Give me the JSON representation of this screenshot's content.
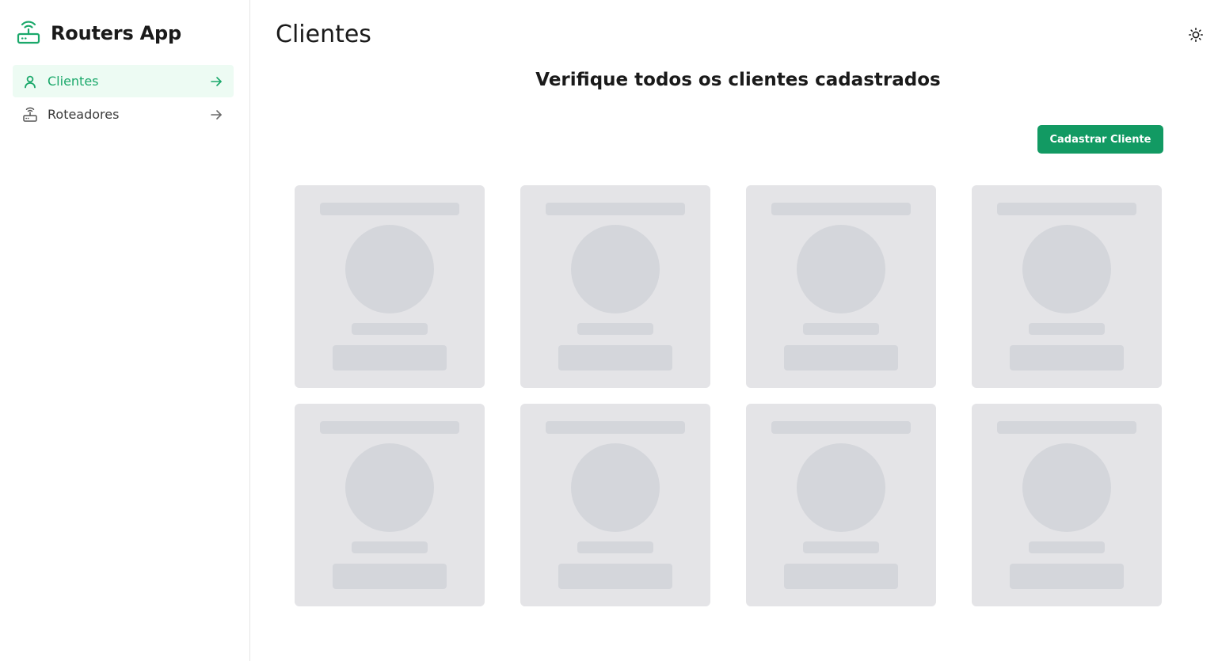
{
  "app": {
    "title": "Routers App",
    "accent": "#1aa86a",
    "button_color": "#129a63"
  },
  "sidebar": {
    "items": [
      {
        "label": "Clientes",
        "icon": "user-icon",
        "active": true
      },
      {
        "label": "Roteadores",
        "icon": "router-icon",
        "active": false
      }
    ]
  },
  "header": {
    "title": "Clientes",
    "theme_icon": "sun-icon"
  },
  "main": {
    "subtitle": "Verifique todos os clientes cadastrados",
    "register_button": "Cadastrar Cliente",
    "skeleton_cards": 8
  }
}
